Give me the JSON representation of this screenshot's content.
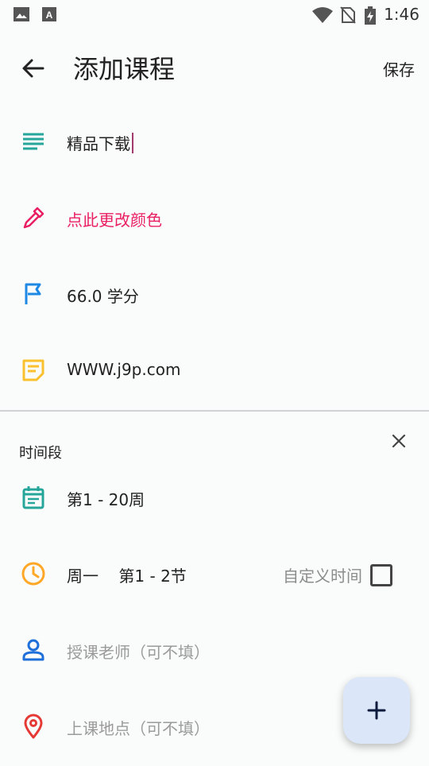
{
  "status": {
    "time": "1:46"
  },
  "appbar": {
    "title": "添加课程",
    "save_label": "保存"
  },
  "course": {
    "name": "精品下载",
    "color_action": "点此更改颜色",
    "color_value": "#e91e63",
    "credits": "66.0 学分",
    "note": "WWW.j9p.com"
  },
  "timeslot": {
    "label": "时间段",
    "weeks": "第1 - 20周",
    "day_periods": "周一    第1 - 2节",
    "custom_time_label": "自定义时间",
    "custom_time_checked": false,
    "teacher_placeholder": "授课老师（可不填）",
    "location_placeholder": "上课地点（可不填）"
  },
  "icons": {
    "status": [
      "image-icon",
      "a-icon",
      "wifi-icon",
      "no-sim-icon",
      "battery-icon"
    ],
    "rows": [
      "notes-icon",
      "eyedropper-icon",
      "flag-icon",
      "sticky-note-icon",
      "calendar-icon",
      "clock-icon",
      "person-icon",
      "location-pin-icon"
    ],
    "actions": [
      "back-arrow-icon",
      "close-icon",
      "plus-icon"
    ]
  }
}
